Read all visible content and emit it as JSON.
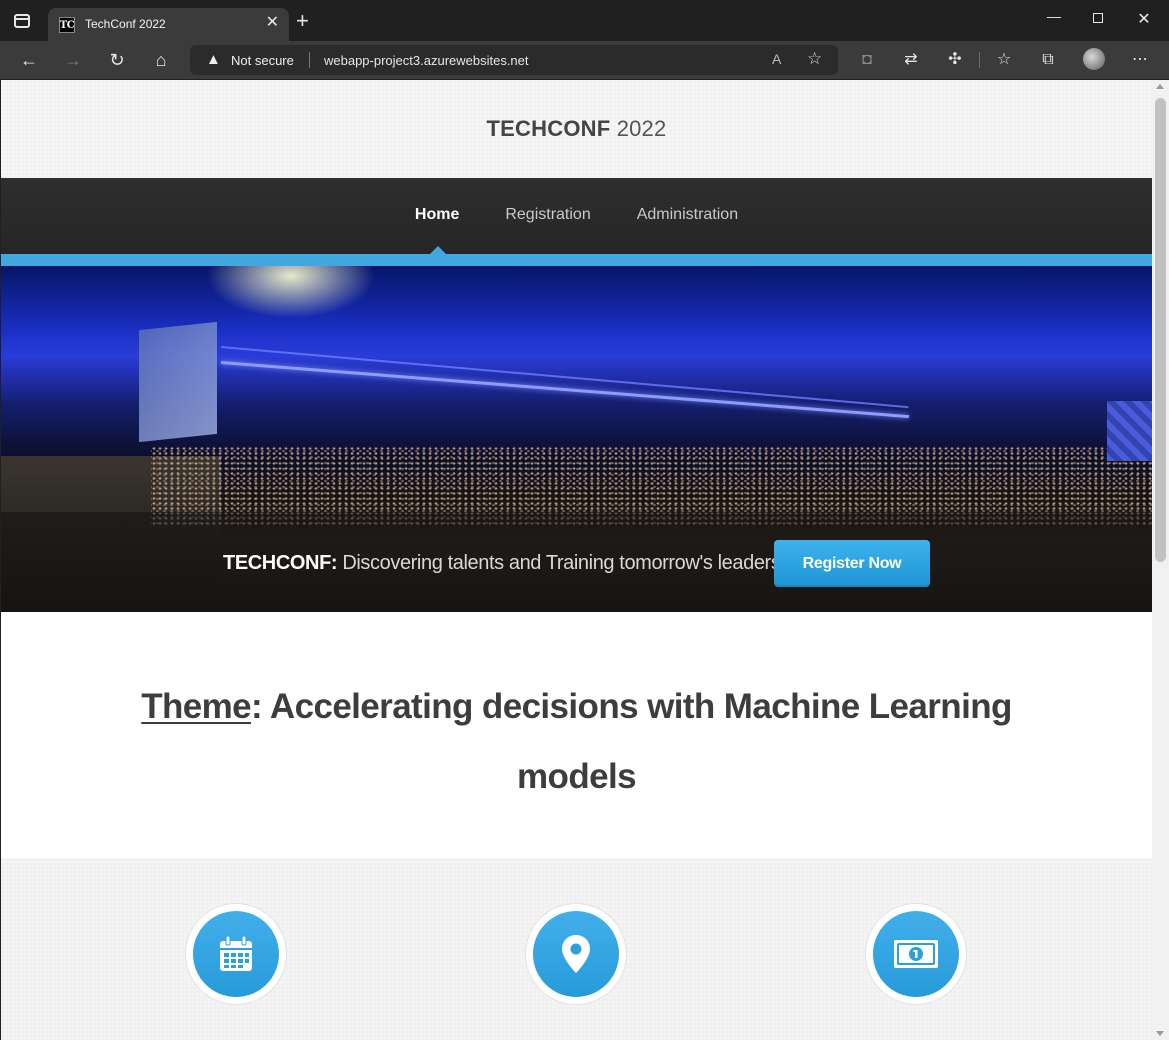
{
  "browser": {
    "tab_title": "TechConf 2022",
    "favicon_text": "TC",
    "address": {
      "security_label": "Not secure",
      "url": "webapp-project3.azurewebsites.net"
    }
  },
  "site": {
    "logo": {
      "brand": "TECHCONF",
      "year": "2022"
    },
    "nav": {
      "items": [
        {
          "label": "Home",
          "active": true
        },
        {
          "label": "Registration",
          "active": false
        },
        {
          "label": "Administration",
          "active": false
        }
      ]
    },
    "hero": {
      "tagline_brand": "TECHCONF:",
      "tagline_text": "Discovering talents and Training tomorrow's leaders",
      "cta_label": "Register Now"
    },
    "theme": {
      "label": "Theme",
      "text": ": Accelerating decisions with Machine Learning models"
    },
    "features": [
      {
        "icon": "calendar-icon"
      },
      {
        "icon": "map-pin-icon"
      },
      {
        "icon": "money-icon"
      }
    ]
  },
  "colors": {
    "accent": "#42a6e0",
    "nav_bg": "#2a2a2a",
    "button": "#2aa3e2"
  }
}
